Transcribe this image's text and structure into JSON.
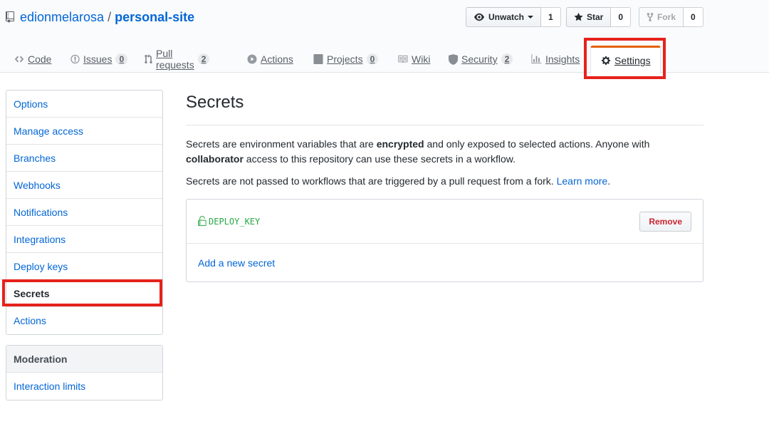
{
  "repo": {
    "owner": "edionmelarosa",
    "separator": "/",
    "name": "personal-site"
  },
  "header_actions": {
    "watch": {
      "label": "Unwatch",
      "count": "1"
    },
    "star": {
      "label": "Star",
      "count": "0"
    },
    "fork": {
      "label": "Fork",
      "count": "0"
    }
  },
  "tabs": [
    {
      "label": "Code",
      "icon": "code-icon"
    },
    {
      "label": "Issues",
      "icon": "issue-icon",
      "count": "0"
    },
    {
      "label": "Pull requests",
      "icon": "pull-request-icon",
      "count": "2"
    },
    {
      "label": "Actions",
      "icon": "play-icon"
    },
    {
      "label": "Projects",
      "icon": "project-icon",
      "count": "0"
    },
    {
      "label": "Wiki",
      "icon": "book-icon"
    },
    {
      "label": "Security",
      "icon": "shield-icon",
      "count": "2"
    },
    {
      "label": "Insights",
      "icon": "graph-icon"
    },
    {
      "label": "Settings",
      "icon": "gear-icon",
      "selected": true
    }
  ],
  "sidebar": {
    "items": [
      {
        "label": "Options"
      },
      {
        "label": "Manage access"
      },
      {
        "label": "Branches"
      },
      {
        "label": "Webhooks"
      },
      {
        "label": "Notifications"
      },
      {
        "label": "Integrations"
      },
      {
        "label": "Deploy keys"
      },
      {
        "label": "Secrets",
        "selected": true
      },
      {
        "label": "Actions"
      }
    ],
    "moderation": {
      "heading": "Moderation",
      "items": [
        {
          "label": "Interaction limits"
        }
      ]
    }
  },
  "main": {
    "title": "Secrets",
    "desc1": {
      "a": "Secrets are environment variables that are ",
      "b": "encrypted",
      "c": " and only exposed to selected actions. Anyone with ",
      "d": "collaborator",
      "e": " access to this repository can use these secrets in a workflow."
    },
    "desc2": {
      "text": "Secrets are not passed to workflows that are triggered by a pull request from a fork. ",
      "link": "Learn more",
      "end": "."
    },
    "secrets": [
      {
        "name": "DEPLOY_KEY",
        "remove_label": "Remove"
      }
    ],
    "add_secret_label": "Add a new secret"
  },
  "colors": {
    "link": "#0366d6",
    "tab_accent": "#e36209",
    "highlight": "#e5221b",
    "secret_name": "#28a745",
    "danger": "#cb2431"
  }
}
